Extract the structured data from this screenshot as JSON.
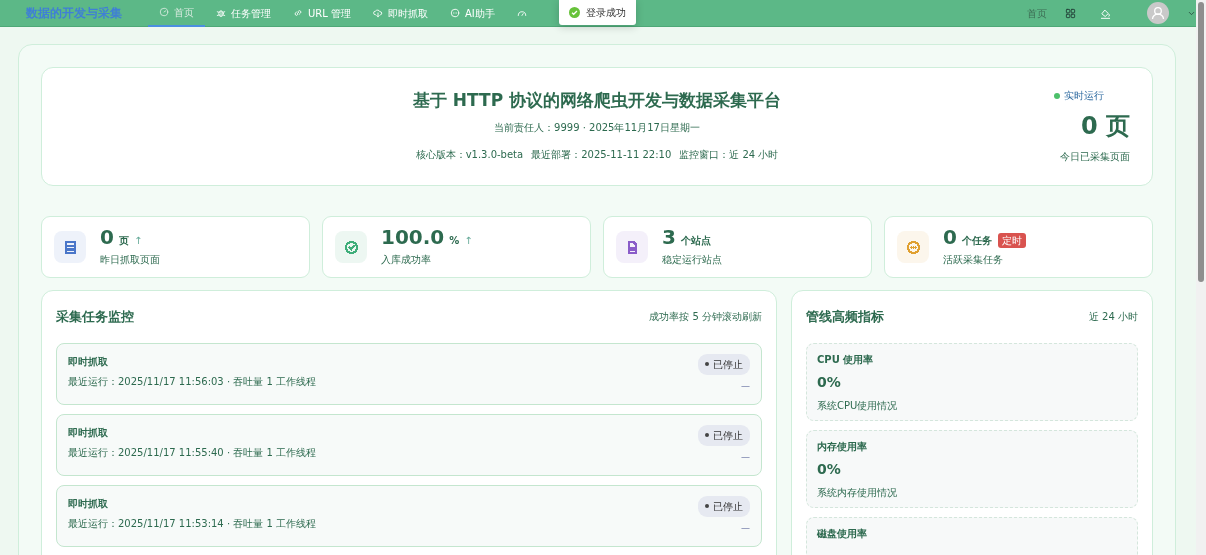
{
  "navbar": {
    "brand": "数据的开发与采集",
    "items": [
      {
        "label": "首页",
        "selected": true
      },
      {
        "label": "任务管理",
        "selected": false
      },
      {
        "label": "URL 管理",
        "selected": false
      },
      {
        "label": "即时抓取",
        "selected": false
      },
      {
        "label": "AI助手",
        "selected": false
      }
    ],
    "home_link": "首页"
  },
  "toast": {
    "text": "登录成功"
  },
  "hero": {
    "title": "基于 HTTP 协议的网络爬虫开发与数据采集平台",
    "subtitle": "当前责任人：9999 · 2025年11月17日星期一",
    "meta": [
      "核心版本：v1.3.0-beta",
      "最近部署：2025-11-11 22:10",
      "监控窗口：近 24 小时"
    ],
    "status": "实时运行",
    "big_value": "0 页",
    "big_caption": "今日已采集页面"
  },
  "stats": [
    {
      "value": "0",
      "unit": "页",
      "trend": "↑",
      "label": "昨日抓取页面",
      "color": "#4a76c9"
    },
    {
      "value": "100.0",
      "unit": "%",
      "trend": "↑",
      "label": "入库成功率",
      "color": "#3fae7a"
    },
    {
      "value": "3",
      "unit": "个站点",
      "label": "稳定运行站点",
      "color": "#8a5cc9"
    },
    {
      "value": "0",
      "unit": "个任务",
      "tag": "定时",
      "label": "活跃采集任务",
      "color": "#e0a030"
    }
  ],
  "tasks_panel": {
    "title": "采集任务监控",
    "note": "成功率按 5 分钟滚动刷新",
    "tasks": [
      {
        "name": "即时抓取",
        "meta": "最近运行：2025/11/17 11:56:03 · 吞吐量 1 工作线程",
        "status": "已停止",
        "trend": "—"
      },
      {
        "name": "即时抓取",
        "meta": "最近运行：2025/11/17 11:55:40 · 吞吐量 1 工作线程",
        "status": "已停止",
        "trend": "—"
      },
      {
        "name": "即时抓取",
        "meta": "最近运行：2025/11/17 11:53:14 · 吞吐量 1 工作线程",
        "status": "已停止",
        "trend": "—"
      }
    ]
  },
  "metrics_panel": {
    "title": "管线高频指标",
    "note": "近 24 小时",
    "metrics": [
      {
        "label": "CPU 使用率",
        "value": "0%",
        "desc": "系统CPU使用情况"
      },
      {
        "label": "内存使用率",
        "value": "0%",
        "desc": "系统内存使用情况"
      },
      {
        "label": "磁盘使用率"
      }
    ]
  }
}
